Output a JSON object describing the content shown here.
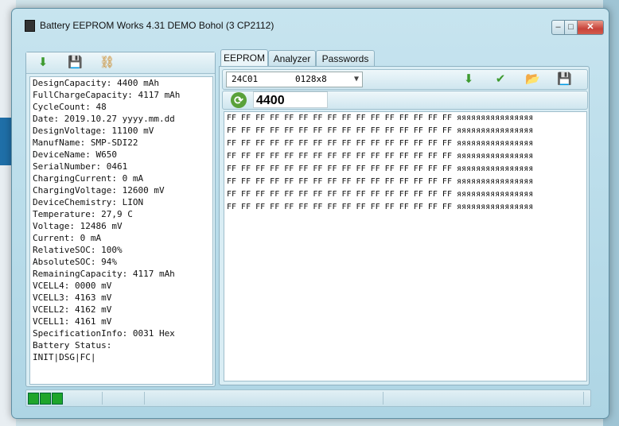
{
  "window": {
    "title": "Battery EEPROM Works  4.31 DEMO Bohol (3 CP2112)",
    "minimize": "–",
    "maximize": "□",
    "close": "✕"
  },
  "left_toolbar": {
    "icons": [
      "download-arrow-icon",
      "save-disk-icon",
      "tree-structure-icon"
    ]
  },
  "battery_info": [
    "DesignCapacity: 4400 mAh",
    "FullChargeCapacity: 4117 mAh",
    "CycleCount: 48",
    "Date: 2019.10.27 yyyy.mm.dd",
    "DesignVoltage: 11100 mV",
    "ManufName: SMP-SDI22",
    "DeviceName: W650",
    "SerialNumber: 0461",
    "ChargingCurrent: 0 mA",
    "ChargingVoltage: 12600 mV",
    "DeviceChemistry: LION",
    "Temperature: 27,9 C",
    "Voltage: 12486 mV",
    "Current: 0 mA",
    "RelativeSOC: 100%",
    "AbsoluteSOC: 94%",
    "RemainingCapacity: 4117 mAh",
    "VCELL4: 0000 mV",
    "VCELL3: 4163 mV",
    "VCELL2: 4162 mV",
    "VCELL1: 4161 mV",
    "SpecificationInfo: 0031 Hex",
    "Battery Status:",
    "INIT|DSG|FC|"
  ],
  "tabs": [
    "EEPROM",
    "Analyzer",
    "Passwords"
  ],
  "eeprom": {
    "chip": "24C01",
    "chip_size": "0128x8",
    "size_value": "4400",
    "toolbar_icons": [
      "download-arrow-icon",
      "check-icon",
      "open-folder-icon",
      "save-disk-icon"
    ],
    "hex_rows": [
      "FF FF FF FF FF FF FF FF FF FF FF FF FF FF FF FF яяяяяяяяяяяяяяяя",
      "FF FF FF FF FF FF FF FF FF FF FF FF FF FF FF FF яяяяяяяяяяяяяяяя",
      "FF FF FF FF FF FF FF FF FF FF FF FF FF FF FF FF яяяяяяяяяяяяяяяя",
      "FF FF FF FF FF FF FF FF FF FF FF FF FF FF FF FF яяяяяяяяяяяяяяяя",
      "FF FF FF FF FF FF FF FF FF FF FF FF FF FF FF FF яяяяяяяяяяяяяяяя",
      "FF FF FF FF FF FF FF FF FF FF FF FF FF FF FF FF яяяяяяяяяяяяяяяя",
      "FF FF FF FF FF FF FF FF FF FF FF FF FF FF FF FF яяяяяяяяяяяяяяяя",
      "FF FF FF FF FF FF FF FF FF FF FF FF FF FF FF FF яяяяяяяяяяяяяяяя"
    ]
  },
  "colors": {
    "led": "#1fa52b",
    "accent_green": "#5aa13a"
  }
}
